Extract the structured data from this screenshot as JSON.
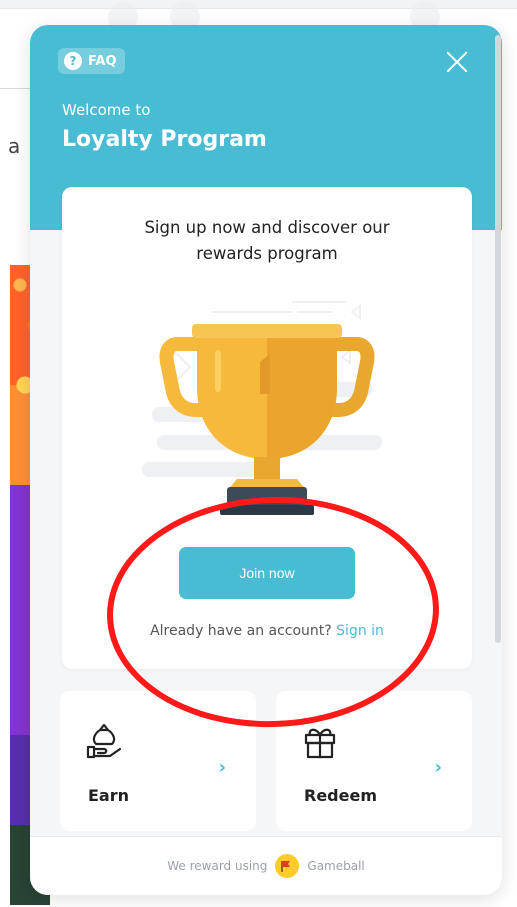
{
  "widget": {
    "faq_label": "FAQ",
    "welcome_text": "Welcome to",
    "program_title": "Loyalty Program",
    "card": {
      "heading_line1": "Sign up now and discover our",
      "heading_line2": "rewards program",
      "join_label": "Join now",
      "account_prompt": "Already have an account?",
      "signin_label": "Sign in"
    },
    "tiles": [
      {
        "label": "Earn",
        "icon": "money-bag-hand-icon"
      },
      {
        "label": "Redeem",
        "icon": "gift-icon"
      }
    ],
    "footer": {
      "prefix": "We reward using",
      "brand": "Gameball"
    },
    "colors": {
      "accent": "#48bcd3",
      "annotation": "#ff1a1a",
      "trophy_gold": "#f6b93b"
    }
  }
}
